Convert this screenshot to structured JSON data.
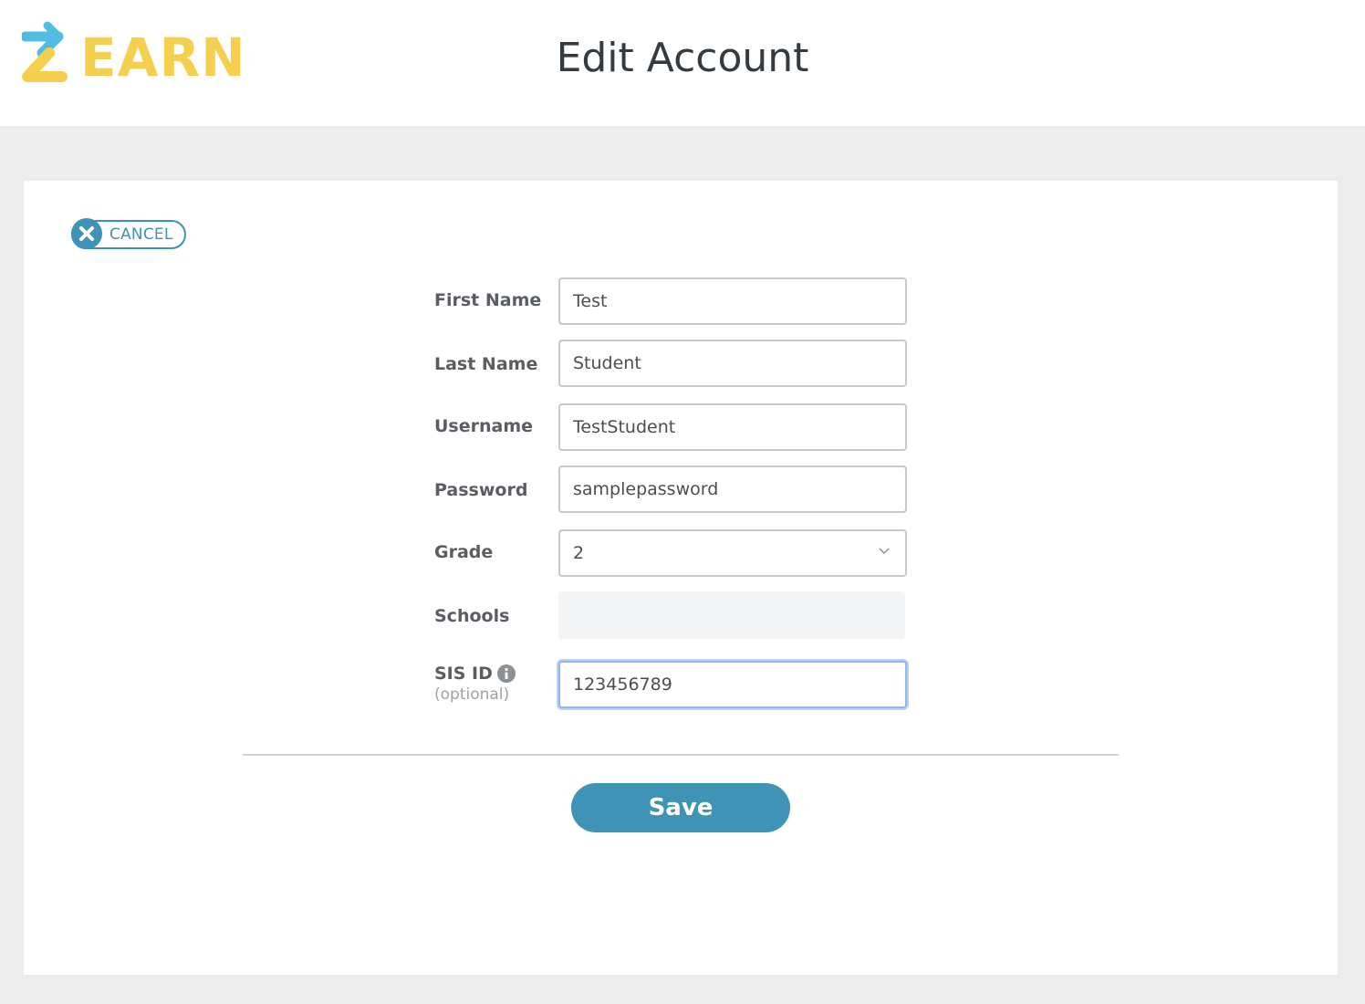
{
  "header": {
    "logo_text": "EARN",
    "title": "Edit Account"
  },
  "cancel": {
    "label": "CANCEL",
    "icon": "close-icon"
  },
  "form": {
    "first_name": {
      "label": "First Name",
      "value": "Test"
    },
    "last_name": {
      "label": "Last Name",
      "value": "Student"
    },
    "username": {
      "label": "Username",
      "value": "TestStudent"
    },
    "password": {
      "label": "Password",
      "value": "samplepassword"
    },
    "grade": {
      "label": "Grade",
      "value": "2",
      "icon": "chevron-down-icon"
    },
    "schools": {
      "label": "Schools",
      "value": ""
    },
    "sis_id": {
      "label": "SIS ID",
      "sublabel": "(optional)",
      "value": "123456789",
      "icon": "info-icon"
    }
  },
  "actions": {
    "save_label": "Save"
  },
  "colors": {
    "brand_yellow": "#f5d04f",
    "brand_blue": "#52bde0",
    "accent": "#3f93b5",
    "page_background": "#ececec"
  }
}
